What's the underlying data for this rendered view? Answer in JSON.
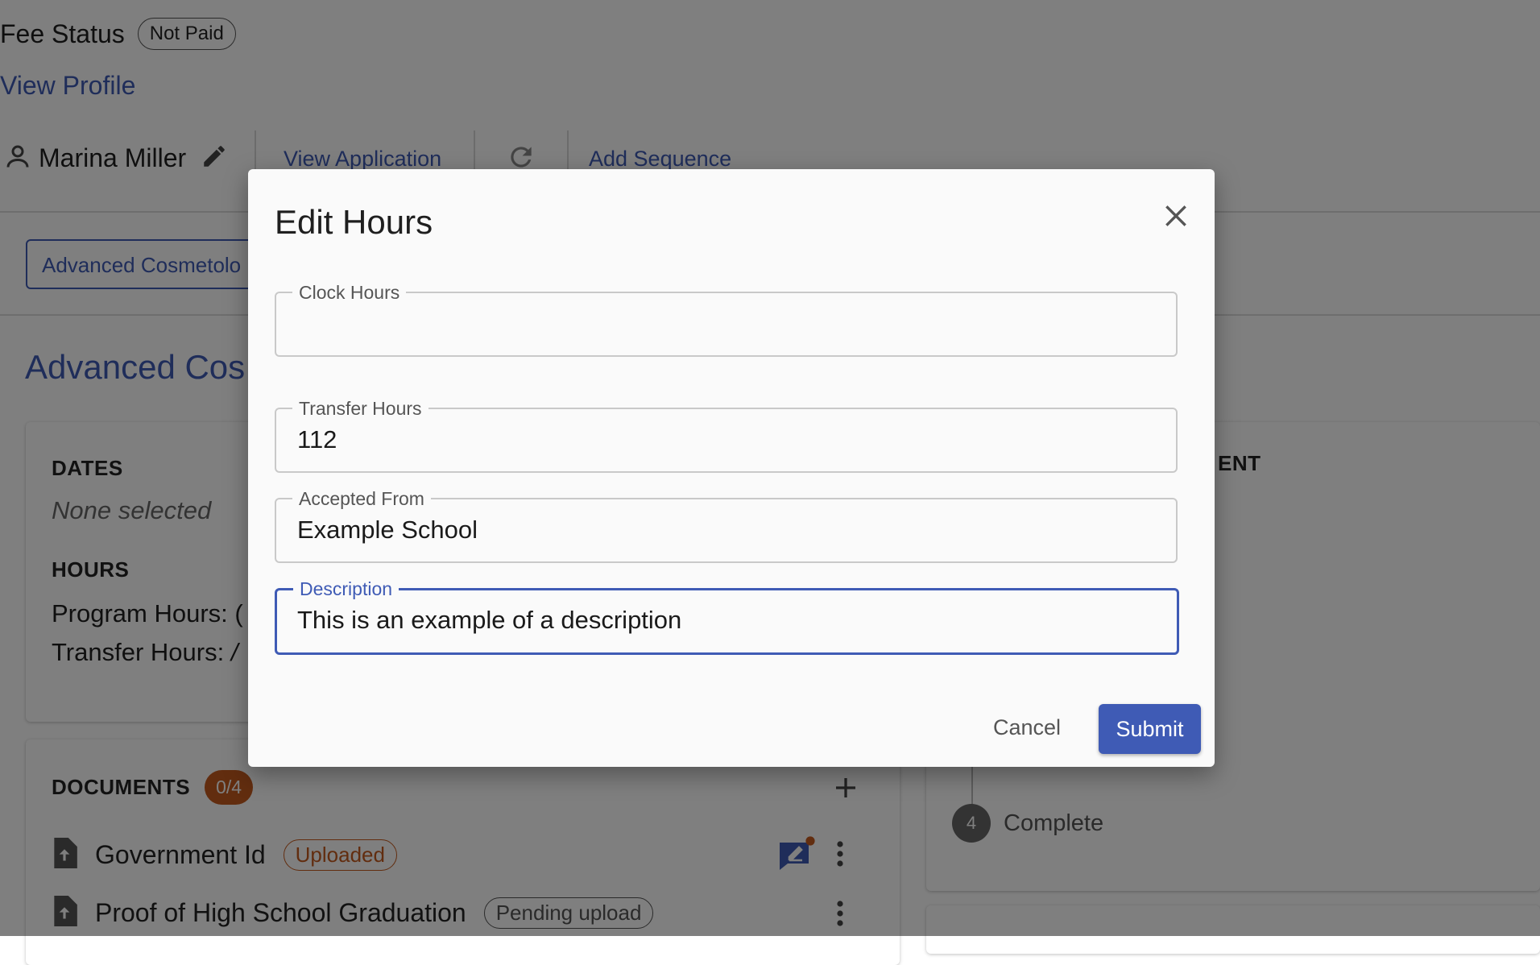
{
  "header": {
    "fee_status_label": "Fee Status",
    "fee_status_value": "Not Paid",
    "view_profile": "View Profile"
  },
  "toolbar": {
    "student_name": "Marina Miller",
    "view_application": "View Application",
    "add_sequence": "Add Sequence"
  },
  "program": {
    "tab_label": "Advanced Cosmetolo",
    "title": "Advanced Cos"
  },
  "dates": {
    "title": "DATES",
    "value": "None selected"
  },
  "hours": {
    "title": "HOURS",
    "program_hours": "Program Hours:",
    "program_hours_value": "(",
    "transfer_hours": "Transfer Hours:",
    "transfer_hours_value": "/"
  },
  "right_panel": {
    "title_fragment": "ENT",
    "step_number": "4",
    "step_label": "Complete"
  },
  "documents": {
    "title": "DOCUMENTS",
    "count": "0/4",
    "items": [
      {
        "name": "Government Id",
        "status": "Uploaded"
      },
      {
        "name": "Proof of High School Graduation",
        "status": "Pending upload"
      }
    ]
  },
  "dialog": {
    "title": "Edit Hours",
    "fields": {
      "clock_hours": {
        "label": "Clock Hours",
        "value": ""
      },
      "transfer_hours": {
        "label": "Transfer Hours",
        "value": "112"
      },
      "accepted_from": {
        "label": "Accepted From",
        "value": "Example School"
      },
      "description": {
        "label": "Description",
        "value": "This is an example of a description"
      }
    },
    "cancel_label": "Cancel",
    "submit_label": "Submit"
  },
  "colors": {
    "primary": "#3f5bb5",
    "badge_orange": "#c45a1e",
    "overlay": "rgba(0,0,0,0.5)"
  }
}
